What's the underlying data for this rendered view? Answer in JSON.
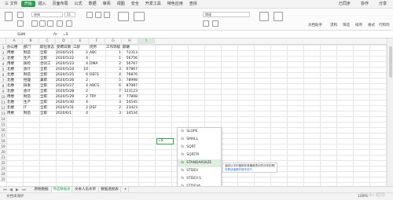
{
  "menubar": {
    "items": [
      "三 文件",
      "开始",
      "插入",
      "页面布局",
      "公式",
      "数据",
      "审阅",
      "视图",
      "安全",
      "开发工具",
      "特色应用",
      "查找"
    ],
    "active_index": 1,
    "right": [
      "已同步",
      "协作",
      "分享"
    ]
  },
  "ribbon": {
    "font_name": "宋体",
    "font_size": "11",
    "number_format": "常规",
    "labels": [
      "文档助手",
      "求和",
      "筛选",
      "排序",
      "格式",
      "行和列"
    ]
  },
  "formula_bar": {
    "name_box": "SUM",
    "fx": "fx",
    "value": "=S"
  },
  "columns": [
    "A",
    "B",
    "C",
    "D",
    "E",
    "F",
    "G",
    "H",
    "I"
  ],
  "selected_column": "I",
  "rows": [
    "1",
    "2",
    "3",
    "4",
    "5",
    "6",
    "7",
    "8",
    "9",
    "10",
    "11",
    "12",
    "13",
    "14",
    "15",
    "16",
    "17",
    "18",
    "19",
    "20",
    "21",
    "22",
    "23",
    "24",
    "25"
  ],
  "table": {
    "headers": [
      "办公楼",
      "部门",
      "职位状态",
      "受聘日期",
      "工龄",
      "优势",
      "工作等级",
      "薪酬"
    ],
    "rows": [
      [
        "用楼",
        "制造",
        "全职",
        "2020/5/21",
        "2",
        "ABC",
        "1",
        "72313"
      ],
      [
        "北楼",
        "生产",
        "全职",
        "2020/5/22",
        "4",
        "",
        "1",
        "56756"
      ],
      [
        "用楼",
        "质检",
        "合同工",
        "2020/5/23",
        "4",
        "DMA",
        "2",
        "56767"
      ],
      [
        "北楼",
        "会计",
        "全职",
        "2020/5/24",
        "10",
        "",
        "3",
        "67867"
      ],
      [
        "北楼",
        "制造",
        "全职",
        "2020/5/25",
        "6",
        "DEFS",
        "4",
        "76876"
      ],
      [
        "北楼",
        "经理",
        "兼职",
        "2020/5/26",
        "2",
        "",
        "5",
        "78998"
      ],
      [
        "北楼",
        "研发",
        "全职",
        "2020/5/27",
        "4",
        "ABCS",
        "6",
        "87987"
      ],
      [
        "北楼",
        "会计",
        "全职",
        "2020/5/28",
        "2",
        "",
        "7",
        "123123"
      ],
      [
        "用楼",
        "制造",
        "全职",
        "2020/5/29",
        "2",
        "TRY",
        "4",
        "77898"
      ],
      [
        "北楼",
        "生产",
        "全职",
        "2020/5/30",
        "4",
        "",
        "3",
        "54545"
      ],
      [
        "北楼",
        "IT",
        "全职",
        "2020/5/31",
        "2",
        "DSF",
        "2",
        "23423"
      ],
      [
        "用楼",
        "制造",
        "全职",
        "2020/6/1",
        "4",
        "",
        "3",
        "34534"
      ]
    ]
  },
  "active_cell": {
    "value": "=S"
  },
  "autocomplete": {
    "items": [
      "SLOPE",
      "SMALL",
      "SQRT",
      "SQRTPI",
      "STANDARDIZE",
      "STDEV",
      "STDEV.S",
      "STDEVA",
      "STDEVP"
    ],
    "selected_index": 4,
    "fx": "fx"
  },
  "tooltip": {
    "description": "返回以平均值和标准偏差表示的分布的规范化数值",
    "link": "查看该函数的操作技巧"
  },
  "sheets": {
    "tabs": [
      "原始数据",
      "筛选数据表",
      "文本人员水单",
      "数据透视表"
    ],
    "active_index": 1,
    "add": "+"
  },
  "status": {
    "left": "文档未保护",
    "zoom": "100%"
  },
  "watermark": "Baidu 经验"
}
